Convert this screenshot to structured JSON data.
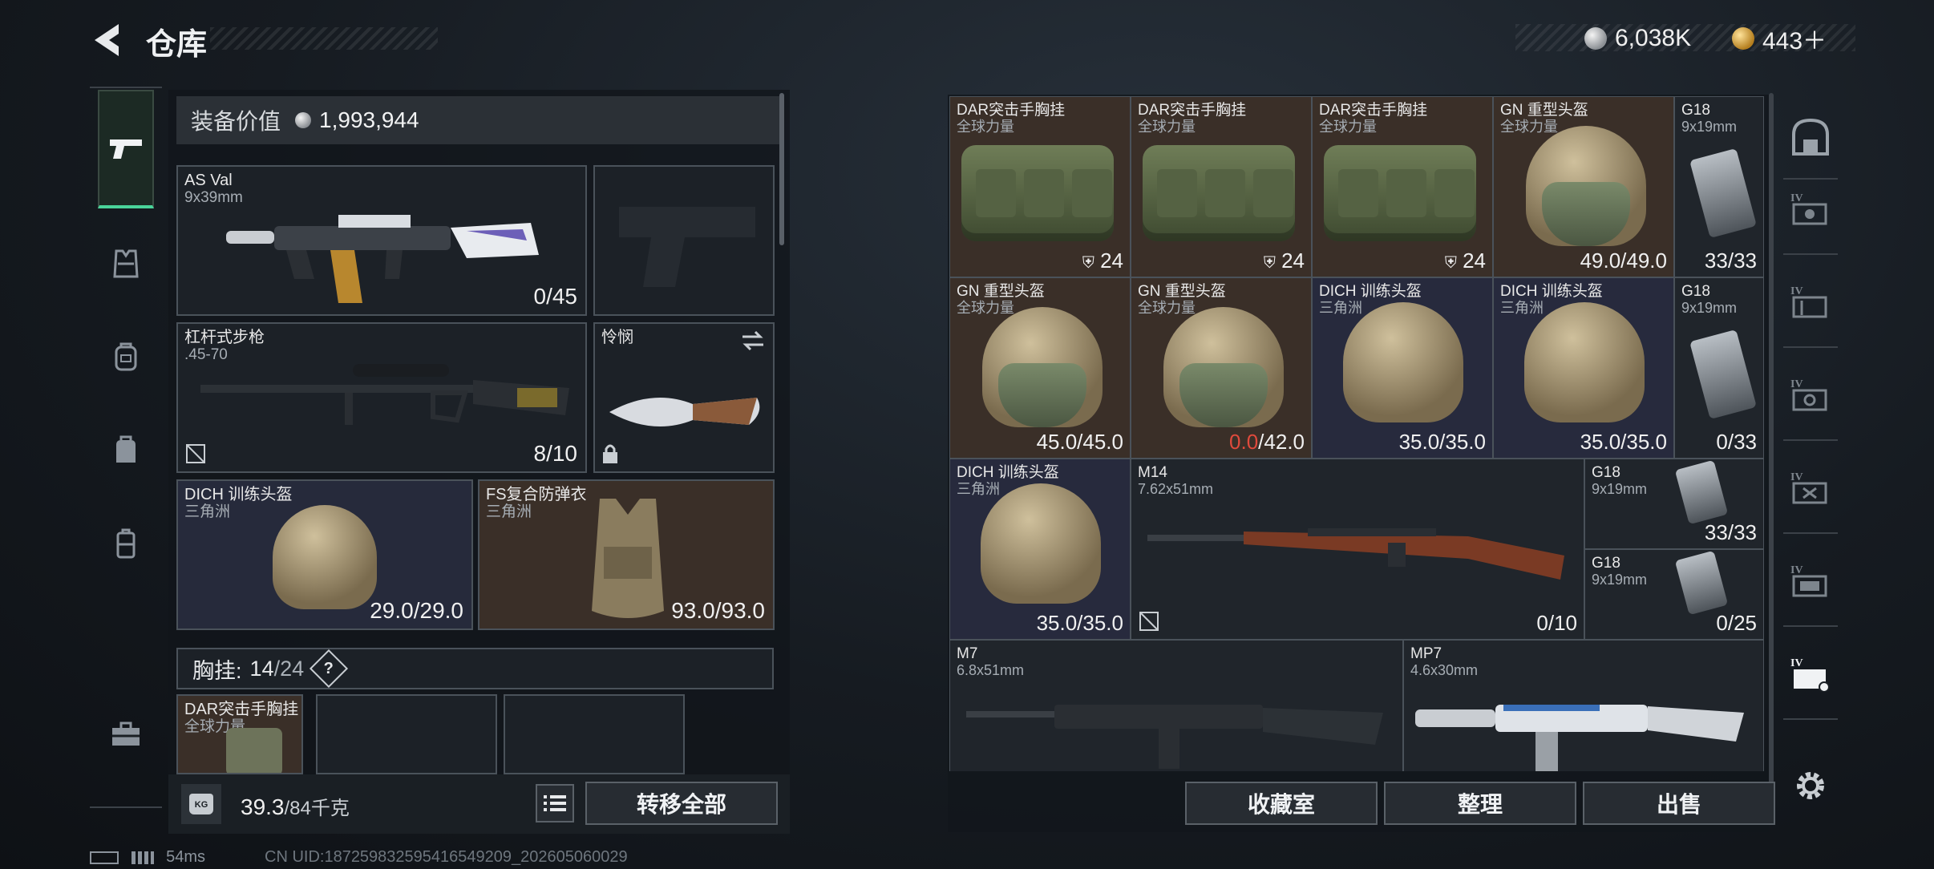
{
  "header": {
    "title": "仓库",
    "back_icon": "back-arrow-icon",
    "currencies": [
      {
        "icon": "silver-coin-icon",
        "value": "6,038K"
      },
      {
        "icon": "gold-coin-icon",
        "value": "443＋"
      }
    ]
  },
  "left_nav": {
    "items": [
      {
        "name": "weapons",
        "icon": "pistol-icon",
        "active": true
      },
      {
        "name": "armor",
        "icon": "vest-icon"
      },
      {
        "name": "backpack",
        "icon": "backpack-icon"
      },
      {
        "name": "pack",
        "icon": "bag-icon"
      },
      {
        "name": "case",
        "icon": "case-icon"
      },
      {
        "name": "toolbox",
        "icon": "toolbox-icon"
      }
    ]
  },
  "loadout": {
    "equip_value_label": "装备价值",
    "equip_value": "1,993,944",
    "slots": {
      "primary": {
        "name": "AS Val",
        "sub": "9x39mm",
        "count": "0/45"
      },
      "pistol": {
        "name": "",
        "sub": "",
        "count": ""
      },
      "secondary": {
        "name": "杠杆式步枪",
        "sub": ".45-70",
        "count": "8/10"
      },
      "melee": {
        "name": "怜悯",
        "sub": "",
        "count": ""
      },
      "helmet": {
        "name": "DICH 训练头盔",
        "sub": "三角洲",
        "count": "29.0/29.0"
      },
      "armor": {
        "name": "FS复合防弹衣",
        "sub": "三角洲",
        "count": "93.0/93.0"
      }
    },
    "chest_rig": {
      "label": "胸挂:",
      "used": "14",
      "total": "/24",
      "help": "?"
    },
    "chest_items": [
      {
        "name": "DAR突击手胸挂",
        "sub": "全球力量"
      },
      {
        "name": "",
        "sub": ""
      },
      {
        "name": "",
        "sub": ""
      }
    ],
    "weight": {
      "current": "39.3",
      "max": "/84千克",
      "unit_icon": "KG"
    },
    "transfer_all": "转移全部"
  },
  "storage": {
    "items": [
      {
        "name": "DAR突击手胸挂",
        "sub": "全球力量",
        "count": "24",
        "icon": "vest-icon",
        "bg": "brown"
      },
      {
        "name": "DAR突击手胸挂",
        "sub": "全球力量",
        "count": "24",
        "icon": "vest-icon",
        "bg": "brown"
      },
      {
        "name": "DAR突击手胸挂",
        "sub": "全球力量",
        "count": "24",
        "icon": "vest-icon",
        "bg": "brown"
      },
      {
        "name": "GN 重型头盔",
        "sub": "全球力量",
        "count": "49.0/49.0",
        "bg": "brown"
      },
      {
        "name": "G18",
        "sub": "9x19mm",
        "count": "33/33",
        "bg": "dark"
      },
      {
        "name": "GN 重型头盔",
        "sub": "全球力量",
        "count": "45.0/45.0",
        "bg": "brown"
      },
      {
        "name": "GN 重型头盔",
        "sub": "全球力量",
        "count_red": "0.0",
        "count": "/42.0",
        "bg": "brown"
      },
      {
        "name": "DICH 训练头盔",
        "sub": "三角洲",
        "count": "35.0/35.0",
        "bg": "purple"
      },
      {
        "name": "DICH 训练头盔",
        "sub": "三角洲",
        "count": "35.0/35.0",
        "bg": "purple"
      },
      {
        "name": "G18",
        "sub": "9x19mm",
        "count": "0/33",
        "bg": "dark"
      },
      {
        "name": "DICH 训练头盔",
        "sub": "三角洲",
        "count": "35.0/35.0",
        "bg": "purple"
      },
      {
        "name": "M14",
        "sub": "7.62x51mm",
        "count": "0/10",
        "bg": "dark"
      },
      {
        "name": "G18",
        "sub": "9x19mm",
        "count": "33/33",
        "bg": "dark"
      },
      {
        "name": "G18",
        "sub": "9x19mm",
        "count": "0/25",
        "bg": "dark"
      },
      {
        "name": "M7",
        "sub": "6.8x51mm",
        "count": "",
        "bg": "dark"
      },
      {
        "name": "MP7",
        "sub": "4.6x30mm",
        "count": "",
        "bg": "dark"
      }
    ],
    "buttons": {
      "collection": "收藏室",
      "sort": "整理",
      "sell": "出售"
    }
  },
  "right_nav": {
    "items": [
      {
        "icon": "warehouse-icon"
      },
      {
        "label": "IV",
        "icon": "container-icon"
      },
      {
        "label": "IV",
        "icon": "container-icon"
      },
      {
        "label": "IV",
        "icon": "container-icon"
      },
      {
        "label": "IV",
        "icon": "container-icon"
      },
      {
        "label": "IV",
        "icon": "container-icon"
      },
      {
        "label": "IV",
        "icon": "container-icon"
      }
    ],
    "settings_icon": "gear-icon"
  },
  "status": {
    "ping": "54ms",
    "uid": "CN UID:187259832595416549209_202605060029"
  }
}
